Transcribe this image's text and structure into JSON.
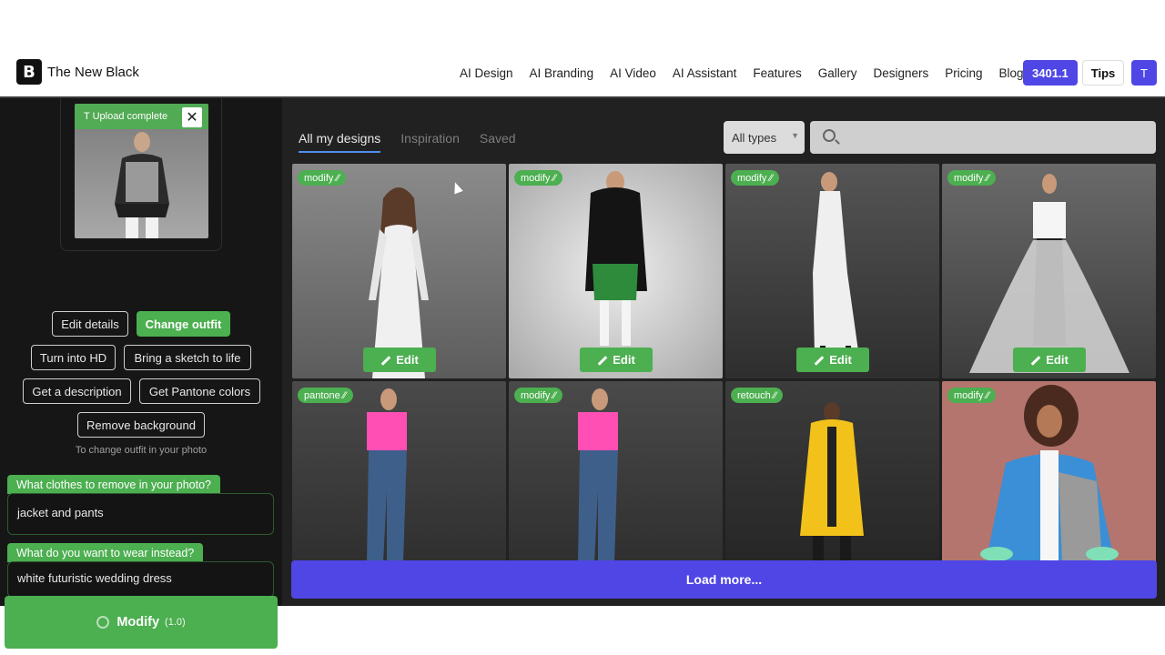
{
  "header": {
    "brand_glyph": "B",
    "brand_name": "The New Black",
    "nav": [
      "AI Design",
      "AI Branding",
      "AI Video",
      "AI Assistant",
      "Features",
      "Gallery",
      "Designers",
      "Pricing",
      "Blog"
    ],
    "credits": "3401.1",
    "tips": "Tips",
    "avatar": "T"
  },
  "sidebar": {
    "upload_status": "T Upload complete",
    "close_glyph": "✕",
    "actions": {
      "edit_details": "Edit details",
      "change_outfit": "Change outfit",
      "turn_into_hd": "Turn into HD",
      "sketch_to_life": "Bring a sketch to life",
      "get_description": "Get a description",
      "get_pantone": "Get Pantone colors",
      "remove_background": "Remove background"
    },
    "hint": "To change outfit in your photo",
    "remove_label": "What clothes to remove in your photo?",
    "remove_value": "jacket and pants",
    "wear_label": "What do you want to wear instead?",
    "wear_value": "white futuristic wedding dress",
    "modify_label": "Modify",
    "modify_version": "(1.0)"
  },
  "main": {
    "tabs": [
      "All my designs",
      "Inspiration",
      "Saved"
    ],
    "type_filter": "All types",
    "search_placeholder": "",
    "cards": [
      {
        "badge": "modify ⁄⁄",
        "edit": "Edit"
      },
      {
        "badge": "modify ⁄⁄",
        "edit": "Edit"
      },
      {
        "badge": "modify ⁄⁄",
        "edit": "Edit"
      },
      {
        "badge": "modify ⁄⁄",
        "edit": "Edit"
      },
      {
        "badge": "pantone ⁄⁄"
      },
      {
        "badge": "modify ⁄⁄"
      },
      {
        "badge": "retouch ⁄⁄"
      },
      {
        "badge": "modify ⁄⁄"
      }
    ],
    "load_more": "Load more..."
  },
  "colors": {
    "accent_green": "#4caf50",
    "accent_indigo": "#4f46e5",
    "panel_dark": "#161616"
  }
}
